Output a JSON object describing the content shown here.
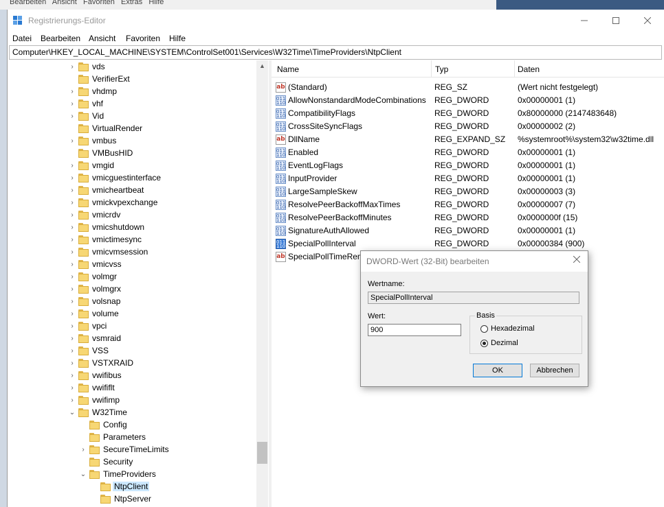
{
  "window": {
    "title": "Registrierungs-Editor"
  },
  "menu": [
    "Datei",
    "Bearbeiten",
    "Ansicht",
    "Favoriten",
    "Hilfe"
  ],
  "address": "Computer\\HKEY_LOCAL_MACHINE\\SYSTEM\\ControlSet001\\Services\\W32Time\\TimeProviders\\NtpClient",
  "tree": [
    {
      "label": "vds",
      "indent": 0,
      "expander": "collapsed"
    },
    {
      "label": "VerifierExt",
      "indent": 0,
      "expander": "none"
    },
    {
      "label": "vhdmp",
      "indent": 0,
      "expander": "collapsed"
    },
    {
      "label": "vhf",
      "indent": 0,
      "expander": "collapsed"
    },
    {
      "label": "Vid",
      "indent": 0,
      "expander": "collapsed"
    },
    {
      "label": "VirtualRender",
      "indent": 0,
      "expander": "none"
    },
    {
      "label": "vmbus",
      "indent": 0,
      "expander": "collapsed"
    },
    {
      "label": "VMBusHID",
      "indent": 0,
      "expander": "none"
    },
    {
      "label": "vmgid",
      "indent": 0,
      "expander": "collapsed"
    },
    {
      "label": "vmicguestinterface",
      "indent": 0,
      "expander": "collapsed"
    },
    {
      "label": "vmicheartbeat",
      "indent": 0,
      "expander": "collapsed"
    },
    {
      "label": "vmickvpexchange",
      "indent": 0,
      "expander": "collapsed"
    },
    {
      "label": "vmicrdv",
      "indent": 0,
      "expander": "collapsed"
    },
    {
      "label": "vmicshutdown",
      "indent": 0,
      "expander": "collapsed"
    },
    {
      "label": "vmictimesync",
      "indent": 0,
      "expander": "collapsed"
    },
    {
      "label": "vmicvmsession",
      "indent": 0,
      "expander": "collapsed"
    },
    {
      "label": "vmicvss",
      "indent": 0,
      "expander": "collapsed"
    },
    {
      "label": "volmgr",
      "indent": 0,
      "expander": "collapsed"
    },
    {
      "label": "volmgrx",
      "indent": 0,
      "expander": "collapsed"
    },
    {
      "label": "volsnap",
      "indent": 0,
      "expander": "collapsed"
    },
    {
      "label": "volume",
      "indent": 0,
      "expander": "collapsed"
    },
    {
      "label": "vpci",
      "indent": 0,
      "expander": "collapsed"
    },
    {
      "label": "vsmraid",
      "indent": 0,
      "expander": "collapsed"
    },
    {
      "label": "VSS",
      "indent": 0,
      "expander": "collapsed"
    },
    {
      "label": "VSTXRAID",
      "indent": 0,
      "expander": "collapsed"
    },
    {
      "label": "vwifibus",
      "indent": 0,
      "expander": "collapsed"
    },
    {
      "label": "vwififlt",
      "indent": 0,
      "expander": "collapsed"
    },
    {
      "label": "vwifimp",
      "indent": 0,
      "expander": "collapsed"
    },
    {
      "label": "W32Time",
      "indent": 0,
      "expander": "expanded"
    },
    {
      "label": "Config",
      "indent": 1,
      "expander": "none"
    },
    {
      "label": "Parameters",
      "indent": 1,
      "expander": "none"
    },
    {
      "label": "SecureTimeLimits",
      "indent": 1,
      "expander": "collapsed"
    },
    {
      "label": "Security",
      "indent": 1,
      "expander": "none"
    },
    {
      "label": "TimeProviders",
      "indent": 1,
      "expander": "expanded"
    },
    {
      "label": "NtpClient",
      "indent": 2,
      "expander": "none",
      "selected": true
    },
    {
      "label": "NtpServer",
      "indent": 2,
      "expander": "none"
    }
  ],
  "columns": {
    "name": "Name",
    "type": "Typ",
    "data": "Daten"
  },
  "values": [
    {
      "icon": "string-value-icon",
      "kind": "sz",
      "name": "(Standard)",
      "type": "REG_SZ",
      "data": "(Wert nicht festgelegt)"
    },
    {
      "icon": "binary-value-icon",
      "kind": "bin",
      "name": "AllowNonstandardModeCombinations",
      "type": "REG_DWORD",
      "data": "0x00000001 (1)"
    },
    {
      "icon": "binary-value-icon",
      "kind": "bin",
      "name": "CompatibilityFlags",
      "type": "REG_DWORD",
      "data": "0x80000000 (2147483648)"
    },
    {
      "icon": "binary-value-icon",
      "kind": "bin",
      "name": "CrossSiteSyncFlags",
      "type": "REG_DWORD",
      "data": "0x00000002 (2)"
    },
    {
      "icon": "string-value-icon",
      "kind": "sz",
      "name": "DllName",
      "type": "REG_EXPAND_SZ",
      "data": "%systemroot%\\system32\\w32time.dll"
    },
    {
      "icon": "binary-value-icon",
      "kind": "bin",
      "name": "Enabled",
      "type": "REG_DWORD",
      "data": "0x00000001 (1)"
    },
    {
      "icon": "binary-value-icon",
      "kind": "bin",
      "name": "EventLogFlags",
      "type": "REG_DWORD",
      "data": "0x00000001 (1)"
    },
    {
      "icon": "binary-value-icon",
      "kind": "bin",
      "name": "InputProvider",
      "type": "REG_DWORD",
      "data": "0x00000001 (1)"
    },
    {
      "icon": "binary-value-icon",
      "kind": "bin",
      "name": "LargeSampleSkew",
      "type": "REG_DWORD",
      "data": "0x00000003 (3)"
    },
    {
      "icon": "binary-value-icon",
      "kind": "bin",
      "name": "ResolvePeerBackoffMaxTimes",
      "type": "REG_DWORD",
      "data": "0x00000007 (7)"
    },
    {
      "icon": "binary-value-icon",
      "kind": "bin",
      "name": "ResolvePeerBackoffMinutes",
      "type": "REG_DWORD",
      "data": "0x0000000f (15)"
    },
    {
      "icon": "binary-value-icon",
      "kind": "bin",
      "name": "SignatureAuthAllowed",
      "type": "REG_DWORD",
      "data": "0x00000001 (1)"
    },
    {
      "icon": "binary-value-icon",
      "kind": "bin",
      "name": "SpecialPollInterval",
      "type": "REG_DWORD",
      "data": "0x00000384 (900)",
      "highlighted": true
    },
    {
      "icon": "string-value-icon",
      "kind": "sz",
      "name": "SpecialPollTimeRemaining",
      "type": "",
      "data": ""
    }
  ],
  "dialog": {
    "title": "DWORD-Wert (32-Bit) bearbeiten",
    "name_label": "Wertname:",
    "name_value": "SpecialPollInterval",
    "value_label": "Wert:",
    "value_value": "900",
    "basis_label": "Basis",
    "hex_label": "Hexadezimal",
    "dec_label": "Dezimal",
    "selected_base": "Dezimal",
    "ok_label": "OK",
    "cancel_label": "Abbrechen"
  },
  "background_menu_text": "Bearbeiten   Ansicht   Favoriten   Extras   Hilfe"
}
